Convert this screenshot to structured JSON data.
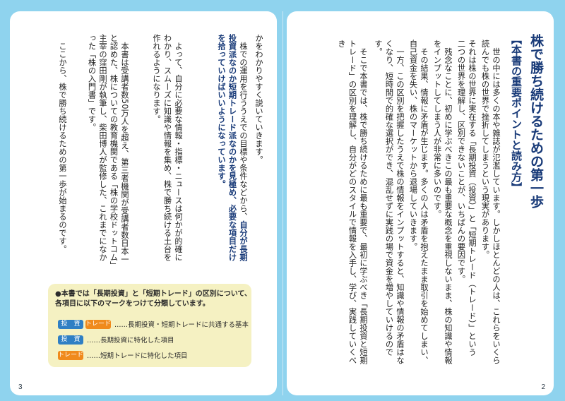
{
  "pages": {
    "left_number": "3",
    "right_number": "2"
  },
  "title": {
    "main": "株で勝ち続けるための第一歩",
    "sub": "【本書の重要ポイントと読み方】"
  },
  "right_body": [
    "　世の中には多くの本や雑誌が氾濫しています。しかしほとんどの人は、これらをいくら読んでも株の世界で挫折してしまうという現実があります。",
    "それは株の世界に実在する「長期投資（投資）」と「短期トレード（トレード）」という二つの世界を理解し、区別できないことが、いちばんの要因です。",
    "　残念なことに、初めに学ぶべきこの最も重要な概念を重視しないまま、株の知識や情報をインプットしてしまう人が非常に多いのです。",
    "　その結果、情報に矛盾が生じます。多くの人は矛盾を抱えたまま取引を始めてしまい、自己資金を失い、株のマーケットから退場していきます。",
    "　一方、この区別を把握したうえで株の情報をインプットすると、知識や情報の矛盾はなくなり、短時間で的確な選択ができ、混乱せずに実践の場で資金を増やしていけるのです。",
    "　そこで本書では、株で勝ち続けるために最も重要で、最初に学ぶべき「長期投資と短期トレード」の区別を理解し、自分がどのスタイルで情報を入手し、学び、実践していくべき"
  ],
  "left_body": {
    "p1": "かをわかりやすく説いていきます。",
    "p2_start": "　株での運用を行ううえでの目標や条件などから、",
    "p2_hl1": "自分が長期投資派なのか短期トレード派なのかを見極め、",
    "p2_hl2": "必要な項目だけを拾っていけばいいようになっています。",
    "p3": "　よって、自分に必要な情報・指標・ニュースは何かが的確にわかり、スムーズに知識や情報を集め、株で勝ち続ける土台を作れるようになります。",
    "p4": "　本書は受講者数50万人を超え、第三者機関が受講者数日本一と認めた、株についての教育機関である「株の学校ドットコム」主宰の窪田剛が執筆し、柴田博人が監修した、これまでになかった「株の入門書」です。",
    "p5": "　ここから、株で勝ち続けるための第一歩が始まるのです。"
  },
  "legend": {
    "intro_line1": "●本書では「長期投資」と「短期トレード」の区別について、",
    "intro_line2": "各項目に以下のマークをつけて分類しています。",
    "badge_invest": "投　資",
    "badge_trade": "トレード",
    "row1_desc": "……長期投資・短期トレードに共通する基本",
    "row2_desc": "……長期投資に特化した項目",
    "row3_desc": "……短期トレードに特化した項目",
    "colors": {
      "invest": "#2f7fc4",
      "trade": "#f08a1c",
      "box": "#f5f1c2",
      "accent": "#183a78"
    }
  }
}
